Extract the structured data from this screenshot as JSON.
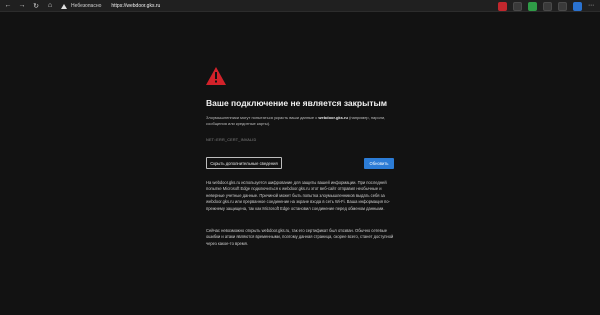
{
  "toolbar": {
    "back_icon": "back-arrow-icon",
    "forward_icon": "forward-arrow-icon",
    "refresh_icon": "refresh-icon",
    "home_icon": "home-icon",
    "security_label": "Небезопасно",
    "url": "https://webdoor.gks.ru",
    "right_icons": [
      "extension-icon",
      "favorite-icon",
      "extension-icon",
      "favorites-icon",
      "collections-icon",
      "profile-icon",
      "settings-more-icon"
    ]
  },
  "error_page": {
    "title": "Ваше подключение не является закрытым",
    "description_prefix": "Злоумышленники могут попытаться украсть ваши данные с ",
    "description_domain": "webdoor.gks.ru",
    "description_suffix": " (например, пароли, сообщения или кредитные карты).",
    "error_code": "NET::ERR_CERT_INVALID",
    "details_button": "Скрыть дополнительные сведения",
    "refresh_button": "Обновить",
    "paragraph1": "На webdoor.gks.ru используется шифрование для защиты вашей информации. При последней попытке Microsoft Edge подключиться к webdoor.gks.ru этот веб-сайт отправил необычные и неверные учетные данные. Причиной может быть попытка злоумышленников выдать себя за webdoor.gks.ru или прерванное соединение на экране входа в сеть Wi-Fi. Ваша информация по-прежнему защищена, так как Microsoft Edge остановил соединение перед обменом данными.",
    "paragraph2": "Сейчас невозможно открыть webdoor.gks.ru, так его сертификат был отозван. Обычно сетевые ошибки и атаки являются временными, поэтому данная страница, скорее всего, станет доступной через какое-то время."
  },
  "colors": {
    "background": "#121212",
    "warning_red": "#d3222a",
    "accent_blue": "#2c7cd6"
  }
}
